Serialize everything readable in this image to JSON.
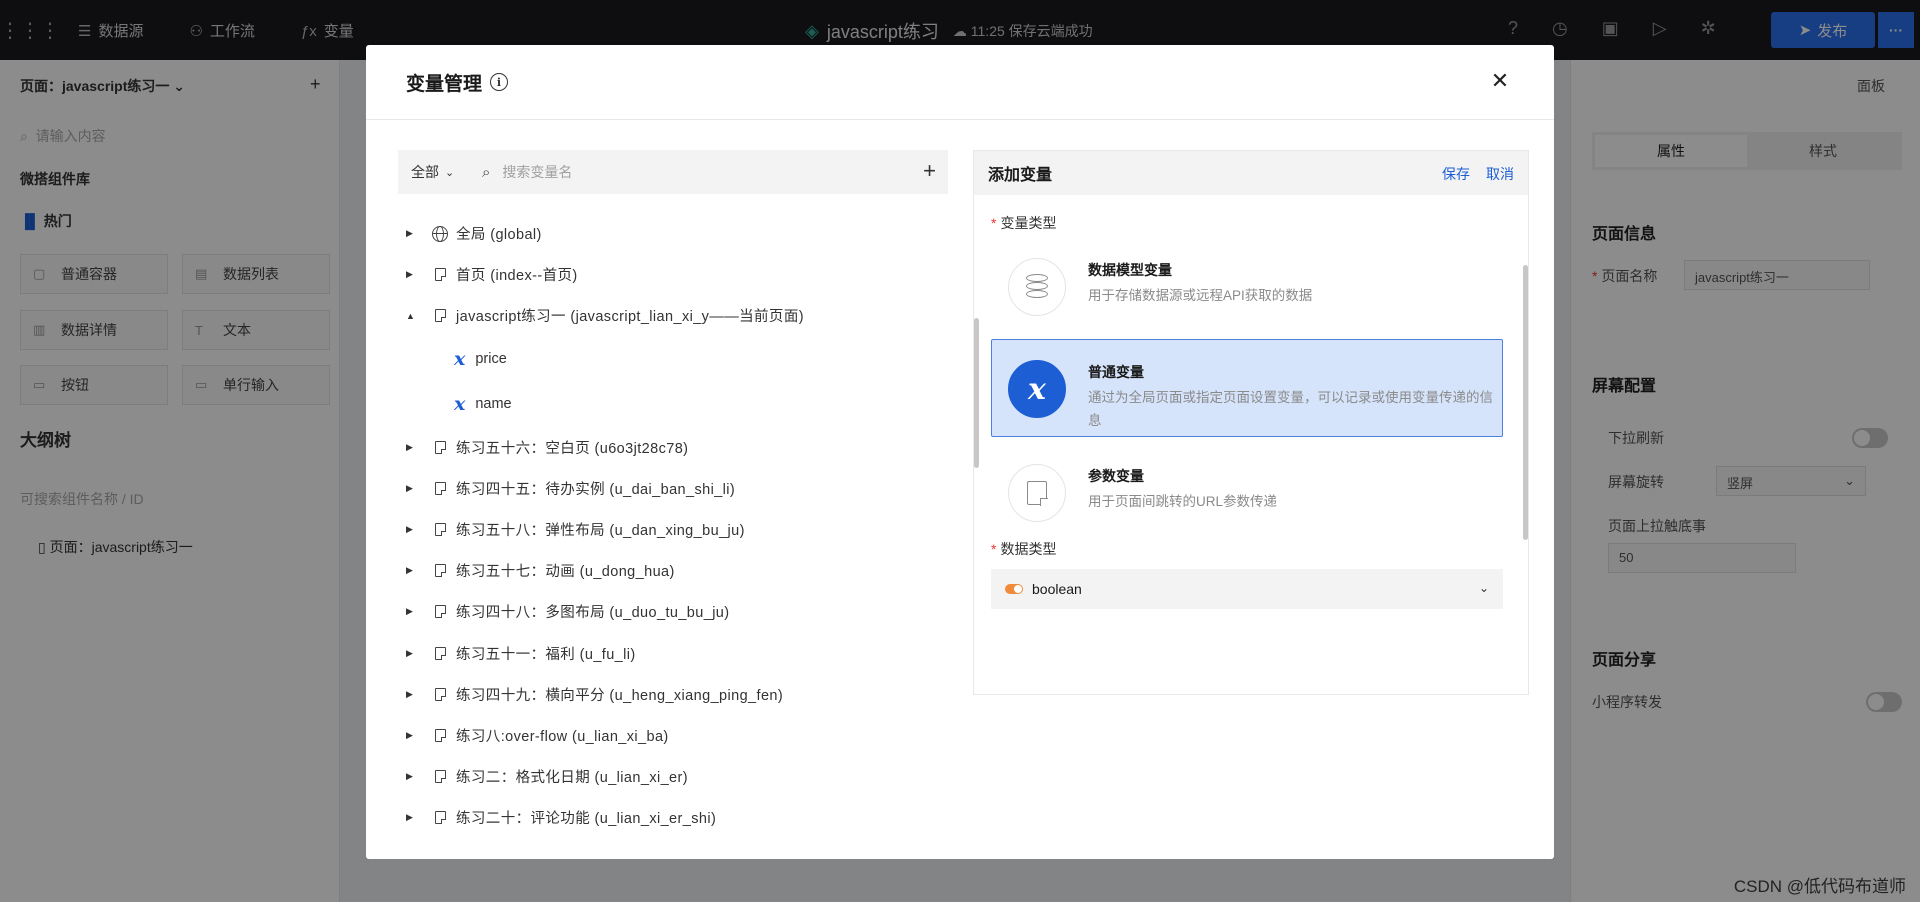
{
  "topbar": {
    "nav": [
      {
        "icon": "database-icon",
        "label": "数据源"
      },
      {
        "icon": "workflow-icon",
        "label": "工作流"
      },
      {
        "icon": "fx-icon",
        "label": "变量"
      }
    ],
    "project_title": "javascript练习",
    "save_status": "11:25 保存云端成功",
    "publish_label": "发布"
  },
  "left_panel": {
    "page_selector": "页面：javascript练习一",
    "search_placeholder": "请输入内容",
    "library_title": "微搭组件库",
    "hot_title": "热门",
    "components": [
      "普通容器",
      "数据列表",
      "数据详情",
      "文本",
      "按钮",
      "单行输入"
    ],
    "outline_title": "大纲树",
    "outline_search_placeholder": "可搜索组件名称 / ID",
    "outline_root": "页面：javascript练习一"
  },
  "right_panel": {
    "header": "面板",
    "tabs": [
      "属性",
      "样式"
    ],
    "active_tab": "属性",
    "page_info_title": "页面信息",
    "page_name_label": "页面名称",
    "page_name_value": "javascript练习一",
    "screen_title": "屏幕配置",
    "pull_refresh_label": "下拉刷新",
    "rotate_label": "屏幕旋转",
    "rotate_value": "竖屏",
    "reach_bottom_label": "页面上拉触底事",
    "reach_bottom_value": "50",
    "share_title": "页面分享",
    "mini_share_label": "小程序转发"
  },
  "modal": {
    "title": "变量管理",
    "filter_label": "全部",
    "search_placeholder": "搜索变量名",
    "tree": [
      {
        "expanded": false,
        "icon": "globe",
        "label": "全局 (global)"
      },
      {
        "expanded": false,
        "icon": "page",
        "label": "首页 (index--首页)"
      },
      {
        "expanded": true,
        "icon": "page",
        "label": "javascript练习一 (javascript_lian_xi_y——当前页面)"
      }
    ],
    "variables": [
      "price",
      "name"
    ],
    "tree_rest": [
      {
        "label": "练习五十六：空白页 (u6o3jt28c78)"
      },
      {
        "label": "练习四十五：待办实例 (u_dai_ban_shi_li)"
      },
      {
        "label": "练习五十八：弹性布局 (u_dan_xing_bu_ju)"
      },
      {
        "label": "练习五十七：动画 (u_dong_hua)"
      },
      {
        "label": "练习四十八：多图布局 (u_duo_tu_bu_ju)"
      },
      {
        "label": "练习五十一：福利 (u_fu_li)"
      },
      {
        "label": "练习四十九：横向平分 (u_heng_xiang_ping_fen)"
      },
      {
        "label": "练习八:over-flow (u_lian_xi_ba)"
      },
      {
        "label": "练习二：格式化日期 (u_lian_xi_er)"
      },
      {
        "label": "练习二十：评论功能 (u_lian_xi_er_shi)"
      }
    ],
    "form": {
      "title": "添加变量",
      "save_label": "保存",
      "cancel_label": "取消",
      "type_label": "变量类型",
      "types": [
        {
          "title": "数据模型变量",
          "desc": "用于存储数据源或远程API获取的数据",
          "selected": false
        },
        {
          "title": "普通变量",
          "desc": "通过为全局页面或指定页面设置变量，可以记录或使用变量传递的信息",
          "selected": true
        },
        {
          "title": "参数变量",
          "desc": "用于页面间跳转的URL参数传递",
          "selected": false
        }
      ],
      "data_type_label": "数据类型",
      "data_type_value": "boolean"
    }
  },
  "watermark": "CSDN @低代码布道师",
  "colors": {
    "primary": "#1d5ed4",
    "selected_bg": "#d6e4fb",
    "publish": "#2b6fee"
  }
}
